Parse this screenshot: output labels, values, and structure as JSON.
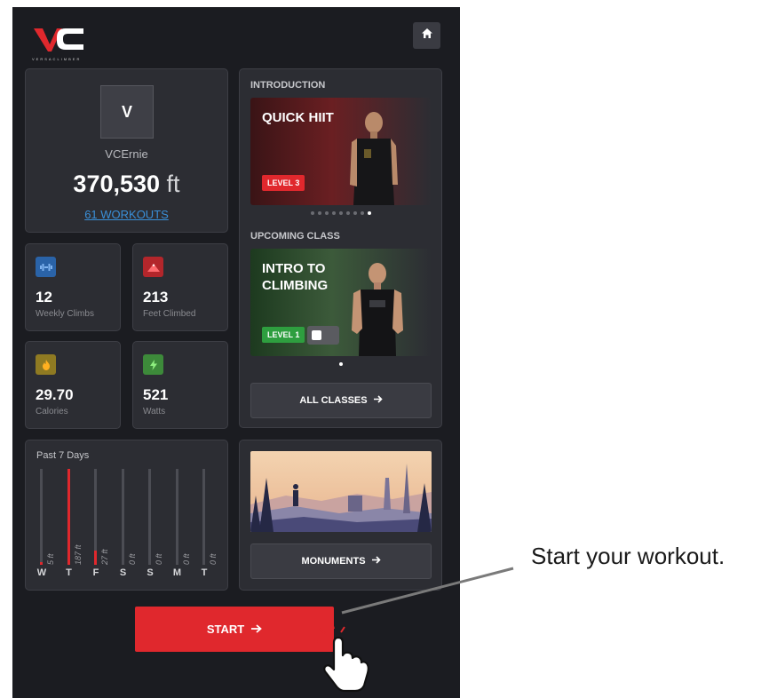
{
  "header": {
    "logo_text": "VC",
    "logo_tagline": "VERSACLIMBER",
    "home_icon": "home-icon"
  },
  "profile": {
    "avatar_initial": "V",
    "username": "VCErnie",
    "distance_value": "370,530",
    "distance_unit": "ft",
    "workouts_link": "61 WORKOUTS"
  },
  "stats": [
    {
      "value": "12",
      "label": "Weekly Climbs",
      "icon": "dumbbell-icon",
      "color": "#2a63a8"
    },
    {
      "value": "213",
      "label": "Feet Climbed",
      "icon": "mountain-icon",
      "color": "#b3262b"
    },
    {
      "value": "29.70",
      "label": "Calories",
      "icon": "flame-icon",
      "color": "#8f7a22"
    },
    {
      "value": "521",
      "label": "Watts",
      "icon": "bolt-icon",
      "color": "#3d8a3a"
    }
  ],
  "week": {
    "title": "Past 7 Days",
    "days": [
      {
        "day": "W",
        "feet": 5,
        "label": "5 ft"
      },
      {
        "day": "T",
        "feet": 187,
        "label": "187 ft"
      },
      {
        "day": "F",
        "feet": 27,
        "label": "27 ft"
      },
      {
        "day": "S",
        "feet": 0,
        "label": "0 ft"
      },
      {
        "day": "S",
        "feet": 0,
        "label": "0 ft"
      },
      {
        "day": "M",
        "feet": 0,
        "label": "0 ft"
      },
      {
        "day": "T",
        "feet": 0,
        "label": "0 ft"
      }
    ],
    "max_feet": 187
  },
  "classes": {
    "intro_title": "INTRODUCTION",
    "intro_class": {
      "title": "QUICK HIIT",
      "level": "LEVEL 3",
      "level_color": "#e0282d"
    },
    "intro_page_count": 9,
    "intro_page_active": 9,
    "upcoming_title": "UPCOMING CLASS",
    "upcoming_class": {
      "title": "INTRO TO\nCLIMBING",
      "level": "LEVEL 1",
      "level_color": "#2e9e3f"
    },
    "all_classes_button": "ALL CLASSES"
  },
  "monuments": {
    "button": "MONUMENTS"
  },
  "start_button": "START",
  "callout": "Start your workout.",
  "accent_color": "#e0282d"
}
